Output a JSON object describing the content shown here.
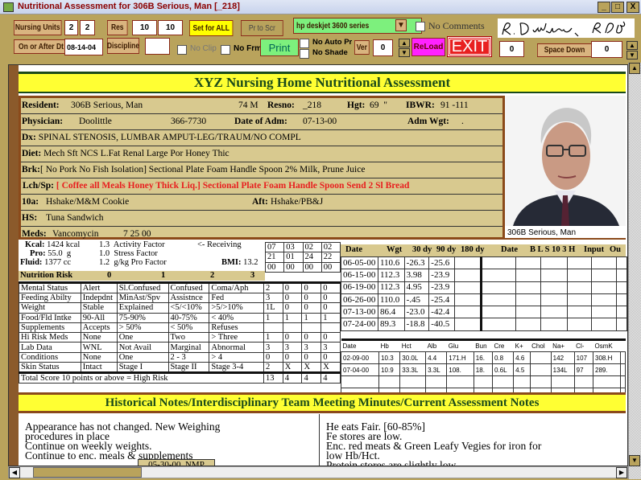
{
  "window": {
    "title": "Nutritional Assessment for 306B Serious, Man [_218]",
    "min": "_",
    "max": "□",
    "close": "X"
  },
  "toolbar": {
    "nursing_units": "Nursing Units",
    "nu1": "2",
    "nu2": "2",
    "res": "Res",
    "res1": "10",
    "res2": "10",
    "set_all": "Set for ALL",
    "pr_to_scr": "Pr to Scr",
    "printer": "hp deskjet 3600 series",
    "no_comments": "No Comments",
    "on_or_after": "On or After Dt",
    "date": "08-14-04",
    "discipline": "Discipline",
    "discipline_value": "",
    "no_clip": "No Clip",
    "no_frm": "No Frm",
    "print": "Print",
    "no_auto_pr": "No Auto Pr",
    "no_shade": "No Shade",
    "ver": "Ver",
    "ver_value": "0",
    "reload": "ReLoad",
    "exit": "EXIT",
    "field_zero": "0",
    "space_down": "Space Down",
    "space_down_value": "0",
    "signature": "R. Dietitian, RD, LD"
  },
  "header": {
    "title": "XYZ Nursing Home Nutritional Assessment"
  },
  "resident": {
    "resident_label": "Resident:",
    "name": "306B Serious, Man",
    "agesex": "74 M",
    "resno_label": "Resno:",
    "resno": "_218",
    "hgt_label": "Hgt:",
    "hgt": "69  \"",
    "ibwr_label": "IBWR:",
    "ibwr": "91 -111",
    "physician_label": "Physician:",
    "physician": "Doolittle",
    "phone": "366-7730",
    "adm_label": "Date of Adm:",
    "adm": "07-13-00",
    "admwgt_label": "Adm Wgt:",
    "admwgt": ".",
    "dx_label": "Dx:",
    "dx": "SPINAL STENOSIS, LUMBAR AMPUT-LEG/TRAUM/NO COMPL",
    "diet_label": "Diet:",
    "diet": "Mech Sft NCS L.Fat  Renal Large Por Honey Thic",
    "brk_label": "Brk:",
    "brk": "[ No Pork No Fish Isolation] Sectional Plate Foam Handle Spoon 2% Milk, Prune Juice",
    "lch_label": "Lch/Sp:",
    "lch": "[ Coffee all Meals Honey Thick Liq.] Sectional Plate Foam Handle Spoon Send 2 Sl Bread",
    "tena_label": "10a:",
    "tena": "Hshake/M&M Cookie",
    "aft_label": "Aft:",
    "aft": "Hshake/PB&J",
    "hs_label": "HS:",
    "hs": "Tuna Sandwich",
    "meds_label": "Meds:",
    "meds": "Vancomycin",
    "meds_date": "7 25 00",
    "photo_caption": "306B Serious, Man"
  },
  "colors": {
    "accent_red": "#e82020",
    "header_yellow": "#ffff33",
    "tan": "#d8c98f",
    "brown": "#8b4a1a"
  },
  "needs": {
    "kcal_label": "Kcal:",
    "kcal": "1424 kcal",
    "pro_label": "Pro:",
    "pro": "55.0  g",
    "fluid_label": "Fluid:",
    "fluid": "1377 cc",
    "activity": "1.3  Activity Factor",
    "stress": "1.0  Stress Factor",
    "gkg": "1.2  g/kg Pro Factor",
    "receiving": "<- Receiving",
    "bmi_label": "BMI:",
    "bmi": "13.2"
  },
  "risk": {
    "header": [
      "Nutrition Risk",
      "0",
      "1",
      "2",
      "3"
    ],
    "dates": [
      [
        "07",
        "03",
        "02",
        "02"
      ],
      [
        "21",
        "01",
        "24",
        "22"
      ],
      [
        "00",
        "00",
        "00",
        "00"
      ]
    ],
    "rows": [
      [
        "Mental Status",
        "Alert",
        "Sl.Confused",
        "Confused",
        "Coma/Aph",
        "2",
        "0",
        "0",
        "0"
      ],
      [
        "Feeding Abilty",
        "Indepdnt",
        "MinAst/Spv",
        "Assistnce",
        "Fed",
        "3",
        "0",
        "0",
        "0"
      ],
      [
        "Weight",
        "Stable",
        "Explained",
        "<5/<10%",
        ">5/>10%",
        "1L",
        "0",
        "0",
        "0"
      ],
      [
        "Food/Fld Intke",
        "90-All",
        "75-90%",
        "40-75%",
        "< 40%",
        "1",
        "1",
        "1",
        "1"
      ],
      [
        "Supplements",
        "Accepts",
        "> 50%",
        "< 50%",
        "Refuses",
        "",
        "",
        "",
        ""
      ],
      [
        "Hi Risk Meds",
        "None",
        "One",
        "Two",
        "> Three",
        "1",
        "0",
        "0",
        "0"
      ],
      [
        "Lab Data",
        "WNL",
        "Not Avail",
        "Marginal",
        "Abnormal",
        "3",
        "3",
        "3",
        "3"
      ],
      [
        "Conditions",
        "None",
        "One",
        "2 - 3",
        "> 4",
        "0",
        "0",
        "0",
        "0"
      ],
      [
        "Skin Status",
        "Intact",
        "Stage I",
        "Stage II",
        "Stage  3-4",
        "2",
        "X",
        "X",
        "X"
      ]
    ],
    "total": [
      "Total Score      10 points or above = High Risk",
      "13",
      "4",
      "4",
      "4"
    ]
  },
  "weights": {
    "header": [
      "Date",
      "Wgt",
      "30 dy",
      "90 dy",
      "180 dy",
      "Date",
      "B L S 10 3 H",
      "Input",
      "Ou"
    ],
    "rows": [
      [
        "06-05-00",
        "110.6",
        "-26.3",
        "-25.6",
        ""
      ],
      [
        "06-15-00",
        "112.3",
        "3.98",
        "-23.9",
        ""
      ],
      [
        "06-19-00",
        "112.3",
        "4.95",
        "-23.9",
        ""
      ],
      [
        "06-26-00",
        "110.0",
        "-.45",
        "-25.4",
        ""
      ],
      [
        "07-13-00",
        "86.4",
        "-23.0",
        "-42.4",
        ""
      ],
      [
        "07-24-00",
        "89.3",
        "-18.8",
        "-40.5",
        ""
      ]
    ]
  },
  "labs": {
    "header": [
      "Date",
      "Hb",
      "Hct",
      "Alb",
      "Glu",
      "Bun",
      "Cre",
      "K+",
      "Chol",
      "Na+",
      "Cl-",
      "OsmK",
      ""
    ],
    "rows": [
      [
        "02-09-00",
        "10.3",
        "30.0L",
        "4.4",
        "171.H",
        "16.",
        "0.8",
        "4.6",
        "",
        "142",
        "107",
        "308.H",
        ""
      ],
      [
        "07-04-00",
        "10.9",
        "33.3L",
        "3.3L",
        "108.",
        "18.",
        "0.6L",
        "4.5",
        "",
        "134L",
        "97",
        "289.",
        ""
      ],
      [
        "",
        "",
        "",
        "",
        "",
        "",
        "",
        "",
        "",
        "",
        "",
        "",
        ""
      ],
      [
        "",
        "",
        "",
        "",
        "",
        "",
        "",
        "",
        "",
        "",
        "",
        "",
        ""
      ]
    ]
  },
  "notes": {
    "header": "Historical Notes/Interdisciplinary Team Meeting Minutes/Current Assessment Notes",
    "left": [
      "Appearance has not changed.  New Weighing",
      "procedures in place",
      "Continue on weekly weights.",
      "Continue to enc. meals & supplements"
    ],
    "left_stamp": "05-30-00  NMP",
    "right": [
      "He eats Fair. [60-85%]",
      "Fe stores are low.",
      "Enc. red meats & Green Leafy Vegies for iron for",
      "low Hb/Hct.",
      "Protein stores are slightly low."
    ]
  }
}
